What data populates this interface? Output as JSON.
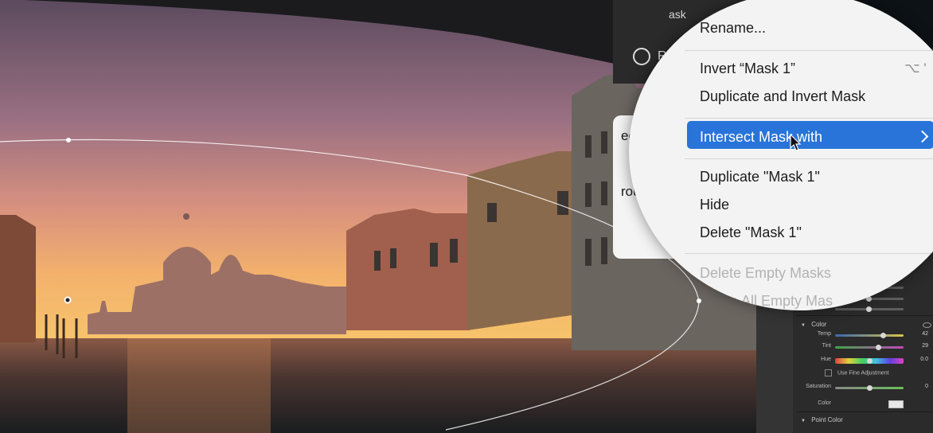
{
  "context_menu": {
    "rename": "Rename...",
    "invert": "Invert “Mask 1”",
    "invert_shortcut": "⌥ '",
    "duplicate_invert": "Duplicate and Invert Mask",
    "intersect": "Intersect Mask with",
    "duplicate": "Duplicate \"Mask 1\"",
    "hide": "Hide",
    "delete": "Delete \"Mask 1\"",
    "delete_empty": "Delete Empty Masks",
    "delete_all_empty": "te All Empty Mas"
  },
  "submenu": {
    "item1": "ect",
    "item2": "round"
  },
  "mask_panel": {
    "header": "ask",
    "radial_tab": "Radi"
  },
  "color_section": {
    "title": "Color",
    "sliders": [
      {
        "label": "Temp",
        "value": "42",
        "position": 0.7
      },
      {
        "label": "Tint",
        "value": "29",
        "position": 0.63
      },
      {
        "label": "Hue",
        "value": "0.0",
        "position": 0.5
      }
    ],
    "fine_adjustment": "Use Fine Adjustment",
    "saturation": {
      "label": "Saturation",
      "value": "0",
      "position": 0.5
    },
    "color_label": "Color"
  },
  "point_color_section": {
    "title": "Point Color"
  },
  "colors": {
    "highlight": "#2874d9",
    "panel": "#2b2b2b",
    "menu_bg": "#f3f3f3"
  }
}
